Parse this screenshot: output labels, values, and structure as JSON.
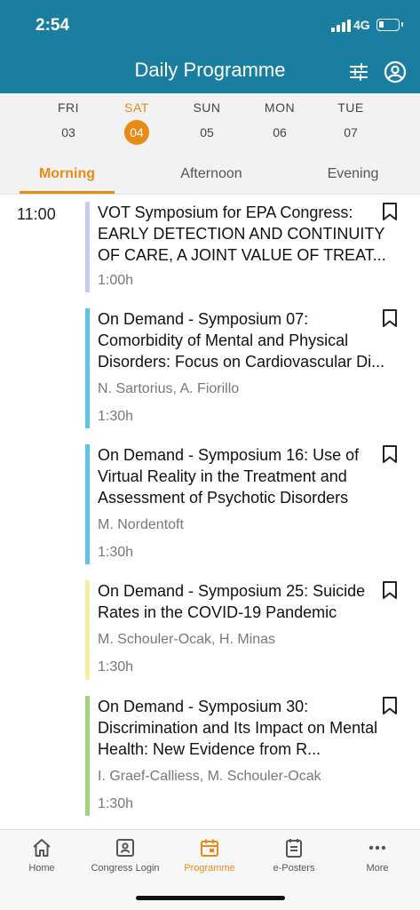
{
  "status_bar": {
    "time": "2:54",
    "network": "4G"
  },
  "header": {
    "title": "Daily Programme",
    "filter_icon": "sliders-icon",
    "user_icon": "user-circle-icon"
  },
  "days": [
    {
      "name": "FRI",
      "num": "03",
      "active": false
    },
    {
      "name": "SAT",
      "num": "04",
      "active": true
    },
    {
      "name": "SUN",
      "num": "05",
      "active": false
    },
    {
      "name": "MON",
      "num": "06",
      "active": false
    },
    {
      "name": "TUE",
      "num": "07",
      "active": false
    }
  ],
  "tabs": [
    {
      "label": "Morning",
      "active": true
    },
    {
      "label": "Afternoon",
      "active": false
    },
    {
      "label": "Evening",
      "active": false
    }
  ],
  "time_slot": "11:00",
  "sessions": [
    {
      "title": "VOT Symposium for EPA Congress: EARLY DETECTION AND CONTINUITY OF CARE, A JOINT VALUE OF TREAT...",
      "speakers": "",
      "duration": "1:00h",
      "color": "#c9c9ec"
    },
    {
      "title": "On Demand - Symposium 07: Comorbidity of Mental and Physical Disorders: Focus on Cardiovascular Di...",
      "speakers": "N. Sartorius, A. Fiorillo",
      "duration": "1:30h",
      "color": "#5bc3e6"
    },
    {
      "title": "On Demand - Symposium 16: Use of Virtual Reality in the Treatment and Assessment of Psychotic Disorders",
      "speakers": "M. Nordentoft",
      "duration": "1:30h",
      "color": "#5bc3e6"
    },
    {
      "title": "On Demand - Symposium 25: Suicide Rates in the COVID-19 Pandemic",
      "speakers": "M. Schouler-Ocak, H. Minas",
      "duration": "1:30h",
      "color": "#f5f0a0"
    },
    {
      "title": "On Demand - Symposium 30: Discrimination and Its Impact on Mental Health: New Evidence from R...",
      "speakers": "I. Graef-Calliess, M. Schouler-Ocak",
      "duration": "1:30h",
      "color": "#9ed37a"
    }
  ],
  "bottom_nav": [
    {
      "label": "Home",
      "icon": "home-icon",
      "active": false
    },
    {
      "label": "Congress Login",
      "icon": "id-card-icon",
      "active": false
    },
    {
      "label": "Programme",
      "icon": "calendar-icon",
      "active": true
    },
    {
      "label": "e-Posters",
      "icon": "document-icon",
      "active": false
    },
    {
      "label": "More",
      "icon": "more-dots-icon",
      "active": false
    }
  ],
  "colors": {
    "brand": "#1a7ea0",
    "accent": "#e98a15"
  }
}
